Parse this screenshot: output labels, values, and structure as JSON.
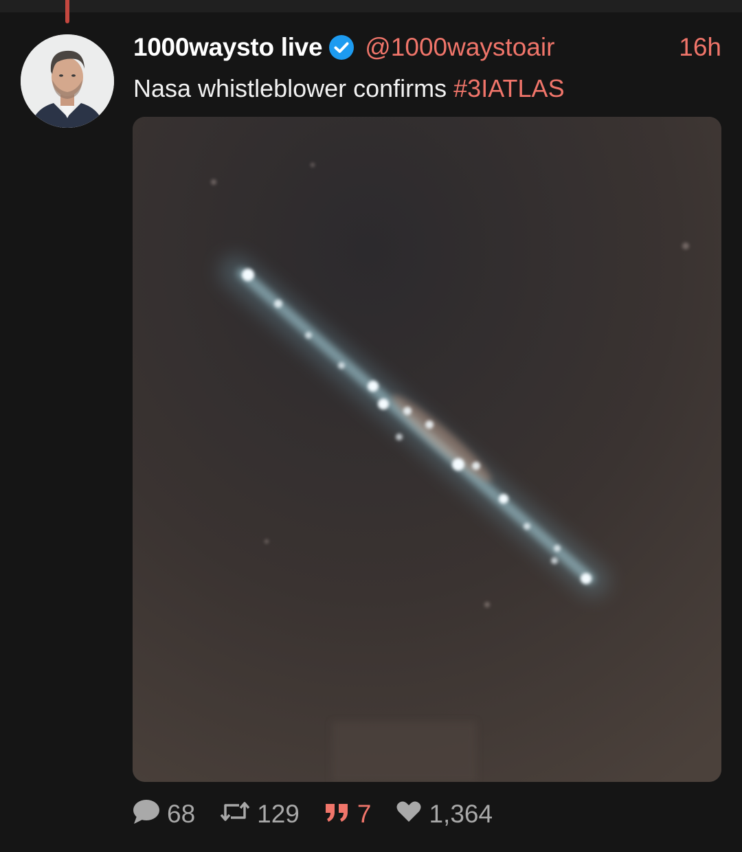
{
  "post": {
    "author": {
      "display_name": "1000waysto live",
      "handle": "@1000waystoair",
      "verified": true
    },
    "timestamp": "16h",
    "text": "Nasa whistleblower confirms ",
    "hashtag": "#3IATLAS",
    "stats": {
      "replies": "68",
      "reposts": "129",
      "quotes": "7",
      "likes": "1,364"
    }
  },
  "icons": {
    "verified": "verified-badge-icon",
    "reply": "speech-bubble-icon",
    "repost": "repost-arrows-icon",
    "quote": "quote-marks-icon",
    "like": "heart-icon"
  },
  "colors": {
    "background": "#151515",
    "accent": "#f0756a",
    "verified_blue": "#1d9bf0",
    "muted": "#a9a9a9"
  }
}
